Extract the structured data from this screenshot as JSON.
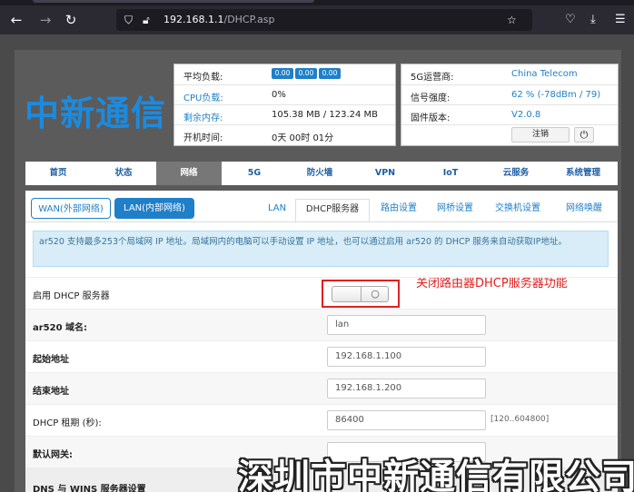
{
  "browser": {
    "url_host": "192.168.1.1",
    "url_path": "/DHCP.asp"
  },
  "logo": "中新通信",
  "status_left": [
    {
      "key": "平均负载:",
      "badges": [
        "0.00",
        "0.00",
        "0.00"
      ]
    },
    {
      "key": "CPU负载:",
      "value": "0%"
    },
    {
      "key": "剩余内存:",
      "value": "105.38 MB / 123.24 MB"
    },
    {
      "key": "开机时间:",
      "value": "0天 00时 01分"
    }
  ],
  "status_right": [
    {
      "key": "5G运营商:",
      "value": "China Telecom"
    },
    {
      "key": "信号强度:",
      "value": "62 % (-78dBm / 79)"
    },
    {
      "key": "固件版本:",
      "value": "V2.0.8"
    }
  ],
  "logout_label": "注销",
  "main_nav": [
    "首页",
    "状态",
    "网络",
    "5G",
    "防火墙",
    "VPN",
    "IoT",
    "云服务",
    "系统管理"
  ],
  "active_main_nav": "网络",
  "sub_tabs_left": [
    "WAN(外部网络)",
    "LAN(内部网络)"
  ],
  "sub_tabs_right": [
    "LAN",
    "DHCP服务器",
    "路由设置",
    "网桥设置",
    "交换机设置",
    "网络唤醒"
  ],
  "info_text": "ar520 支持最多253个局域网 IP 地址。局域网内的电脑可以手动设置 IP 地址，也可以通过启用 ar520 的 DHCP 服务来自动获取IP地址。",
  "annotation": "关闭路由器DHCP服务器功能",
  "form": {
    "dhcp_enable_label": "启用 DHCP 服务器",
    "dhcp_enabled": false,
    "domain_label": "ar520 域名:",
    "domain_value": "lan",
    "start_label": "起始地址",
    "start_value": "192.168.1.100",
    "end_label": "结束地址",
    "end_value": "192.168.1.200",
    "lease_label": "DHCP 租期 (秒):",
    "lease_value": "86400",
    "lease_hint": "[120..604800]",
    "gateway_label": "默认网关:",
    "gateway_value": "",
    "dns_section_label": "DNS 与 WINS 服务器设置"
  },
  "watermark": "深圳市中新通信有限公司",
  "colors": {
    "accent": "#1f7fc8",
    "annotation": "#e02020",
    "nav_active": "#777777"
  }
}
